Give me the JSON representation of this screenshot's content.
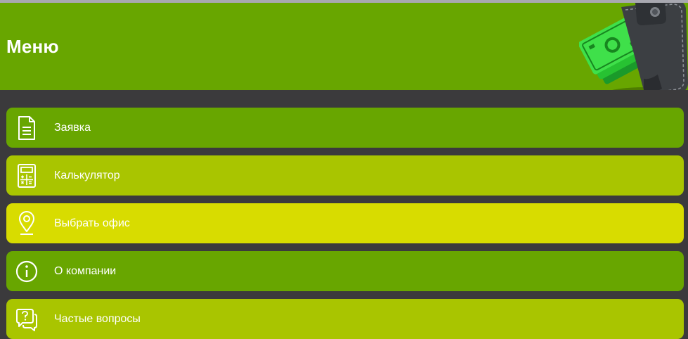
{
  "header": {
    "title": "Меню",
    "background": "#68a600"
  },
  "menu": {
    "items": [
      {
        "label": "Заявка",
        "icon": "document-icon",
        "color": "#68a600"
      },
      {
        "label": "Калькулятор",
        "icon": "calculator-icon",
        "color": "#a9c500"
      },
      {
        "label": "Выбрать офис",
        "icon": "location-pin-icon",
        "color": "#d8dc00"
      },
      {
        "label": "О компании",
        "icon": "info-icon",
        "color": "#68a600"
      },
      {
        "label": "Частые вопросы",
        "icon": "question-bubbles-icon",
        "color": "#a9c500"
      }
    ]
  },
  "colors": {
    "page_background": "#3b3a3c",
    "top_line": "#a8a8b0",
    "text": "#ffffff"
  }
}
